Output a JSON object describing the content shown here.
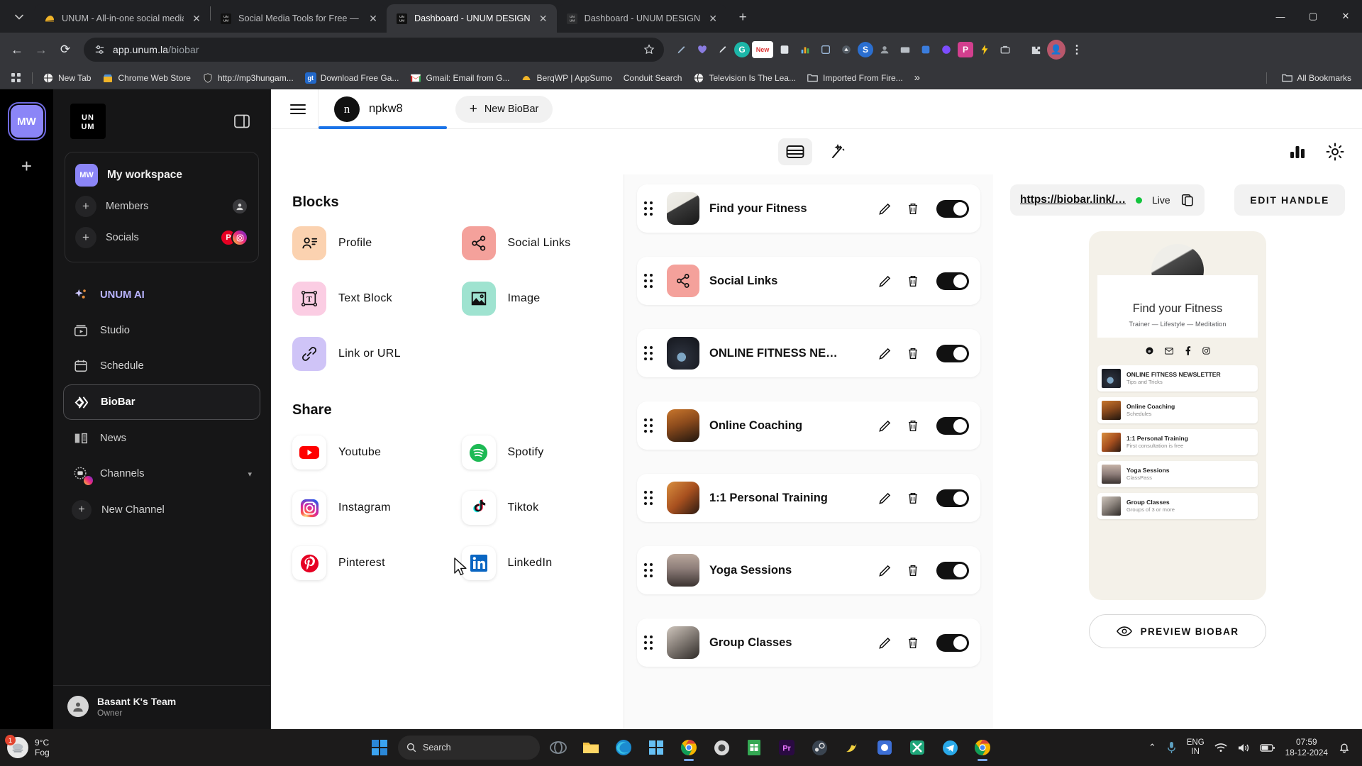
{
  "browser": {
    "tabs": [
      {
        "title": "UNUM - All-in-one social media",
        "favicon": "unum-taco-icon",
        "active": false
      },
      {
        "title": "Social Media Tools for Free — U",
        "favicon": "unum-logo-icon",
        "active": false
      },
      {
        "title": "Dashboard - UNUM DESIGN",
        "favicon": "unum-logo-icon",
        "active": true
      },
      {
        "title": "Dashboard - UNUM DESIGN",
        "favicon": "unum-logo-icon",
        "active": false
      }
    ],
    "new_tab_label": "+",
    "window_controls": {
      "minimize": "—",
      "maximize": "▢",
      "close": "✕"
    },
    "nav": {
      "back": "←",
      "forward": "→",
      "reload": "⟳"
    },
    "omnibox": {
      "url_bold": "app.unum.la",
      "url_dim": "/biobar",
      "site_settings_icon": "tune-icon",
      "bookmark_star_icon": "star-icon"
    },
    "bookmarks": {
      "apps_icon": "apps-grid-icon",
      "items": [
        {
          "label": "New Tab",
          "icon": "globe-icon"
        },
        {
          "label": "Chrome Web Store",
          "icon": "webstore-icon"
        },
        {
          "label": "http://mp3hungam...",
          "icon": "shield-icon"
        },
        {
          "label": "Download Free Ga...",
          "icon": "gt-icon"
        },
        {
          "label": "Gmail: Email from G...",
          "icon": "gmail-icon"
        },
        {
          "label": "BerqWP | AppSumo",
          "icon": "berq-icon"
        },
        {
          "label": "Conduit Search",
          "icon": "none"
        },
        {
          "label": "Television Is The Lea...",
          "icon": "globe-icon"
        },
        {
          "label": "Imported From Fire...",
          "icon": "folder-icon"
        }
      ],
      "overflow_label": "»",
      "all_bookmarks_label": "All Bookmarks",
      "all_bookmarks_icon": "folder-icon"
    }
  },
  "rail": {
    "workspace_initials": "MW",
    "add_label": "+"
  },
  "sidebar": {
    "logo_text": "UNUM",
    "panel_toggle_icon": "panel-collapse-icon",
    "workspace": {
      "initials": "MW",
      "name": "My workspace",
      "rows": [
        {
          "label": "Members",
          "icon": "plus-circle-icon",
          "badges": [
            "member-avatar"
          ]
        },
        {
          "label": "Socials",
          "icon": "plus-circle-icon",
          "badges": [
            "pinterest",
            "instagram"
          ]
        }
      ]
    },
    "nav_items": [
      {
        "label": "UNUM AI",
        "icon": "sparkle-icon",
        "active": false,
        "highlight": true
      },
      {
        "label": "Studio",
        "icon": "studio-icon",
        "active": false
      },
      {
        "label": "Schedule",
        "icon": "calendar-icon",
        "active": false
      },
      {
        "label": "BioBar",
        "icon": "biobar-icon",
        "active": true
      },
      {
        "label": "News",
        "icon": "book-icon",
        "active": false
      },
      {
        "label": "Channels",
        "icon": "channels-icon",
        "active": false,
        "chevron": "▾"
      }
    ],
    "new_channel_label": "New Channel",
    "footer": {
      "name": "Basant K's Team",
      "role": "Owner",
      "avatar_icon": "person-icon"
    }
  },
  "app_header": {
    "menu_icon": "hamburger-icon",
    "biobar_tab": {
      "avatar_letter": "n",
      "name": "npkw8"
    },
    "new_biobar_label": "New BioBar",
    "new_biobar_plus": "+",
    "tools": {
      "layout_icon": "layout-blocks-icon",
      "magic_icon": "magic-wand-icon",
      "analytics_icon": "bar-chart-icon",
      "settings_icon": "gear-icon"
    }
  },
  "blocks_panel": {
    "blocks_title": "Blocks",
    "blocks": [
      {
        "label": "Profile",
        "icon": "profile-icon",
        "bg": "#FBD2B0"
      },
      {
        "label": "Social Links",
        "icon": "share-icon",
        "bg": "#F4A19B"
      },
      {
        "label": "Text Block",
        "icon": "text-block-icon",
        "bg": "#FBCDE3"
      },
      {
        "label": "Image",
        "icon": "image-icon",
        "bg": "#9FE3D0"
      },
      {
        "label": "Link or URL",
        "icon": "link-icon",
        "bg": "#CFC4F7"
      }
    ],
    "share_title": "Share",
    "share": [
      {
        "label": "Youtube",
        "icon": "youtube-icon"
      },
      {
        "label": "Spotify",
        "icon": "spotify-icon"
      },
      {
        "label": "Instagram",
        "icon": "instagram-icon"
      },
      {
        "label": "Tiktok",
        "icon": "tiktok-icon"
      },
      {
        "label": "Pinterest",
        "icon": "pinterest-icon"
      },
      {
        "label": "LinkedIn",
        "icon": "linkedin-icon"
      }
    ]
  },
  "items_list": {
    "edit_icon": "pencil-icon",
    "delete_icon": "trash-icon",
    "items": [
      {
        "label": "Find your Fitness",
        "thumb": "photo",
        "enabled": true
      },
      {
        "label": "Social Links",
        "thumb": "share-pink",
        "enabled": true
      },
      {
        "label": "ONLINE FITNESS NE…",
        "thumb": "photo",
        "enabled": true
      },
      {
        "label": "Online Coaching",
        "thumb": "photo",
        "enabled": true
      },
      {
        "label": "1:1 Personal Training",
        "thumb": "photo",
        "enabled": true
      },
      {
        "label": "Yoga Sessions",
        "thumb": "photo",
        "enabled": true
      },
      {
        "label": "Group Classes",
        "thumb": "photo",
        "enabled": true
      }
    ]
  },
  "preview": {
    "url": "https://biobar.link/…",
    "status": "Live",
    "copy_icon": "copy-icon",
    "edit_handle_label": "EDIT HANDLE",
    "profile": {
      "name": "Find your Fitness",
      "tagline": "Trainer — Lifestyle — Meditation",
      "socials": [
        "threads-icon",
        "mail-icon",
        "facebook-icon",
        "instagram-icon"
      ]
    },
    "links": [
      {
        "title": "ONLINE FITNESS NEWSLETTER",
        "sub": "Tips and Tricks"
      },
      {
        "title": "Online Coaching",
        "sub": "Schedules"
      },
      {
        "title": "1:1 Personal Training",
        "sub": "First consultation is free"
      },
      {
        "title": "Yoga Sessions",
        "sub": "ClassPass"
      },
      {
        "title": "Group Classes",
        "sub": "Groups of 3 or more"
      }
    ],
    "preview_button_label": "PREVIEW BIOBAR",
    "preview_button_icon": "eye-icon"
  },
  "taskbar": {
    "weather": {
      "temp": "9°C",
      "condition": "Fog",
      "badge": "1"
    },
    "search_placeholder": "Search",
    "search_icon": "search-icon",
    "apps": [
      "windows-start-icon",
      "copilot-icon",
      "file-explorer-icon",
      "edge-icon",
      "store-icon",
      "chrome-icon",
      "obs-icon",
      "sheets-icon",
      "premiere-icon",
      "steam-icon",
      "bird-icon",
      "app-icon",
      "x-icon",
      "telegram-icon",
      "chrome-alt-icon"
    ],
    "tray": {
      "chevron": "⌃",
      "mic_icon": "mic-icon",
      "lang_top": "ENG",
      "lang_bottom": "IN",
      "wifi_icon": "wifi-icon",
      "volume_icon": "volume-icon",
      "battery_icon": "battery-icon",
      "time": "07:59",
      "date": "18-12-2024",
      "notification_icon": "bell-icon"
    }
  }
}
